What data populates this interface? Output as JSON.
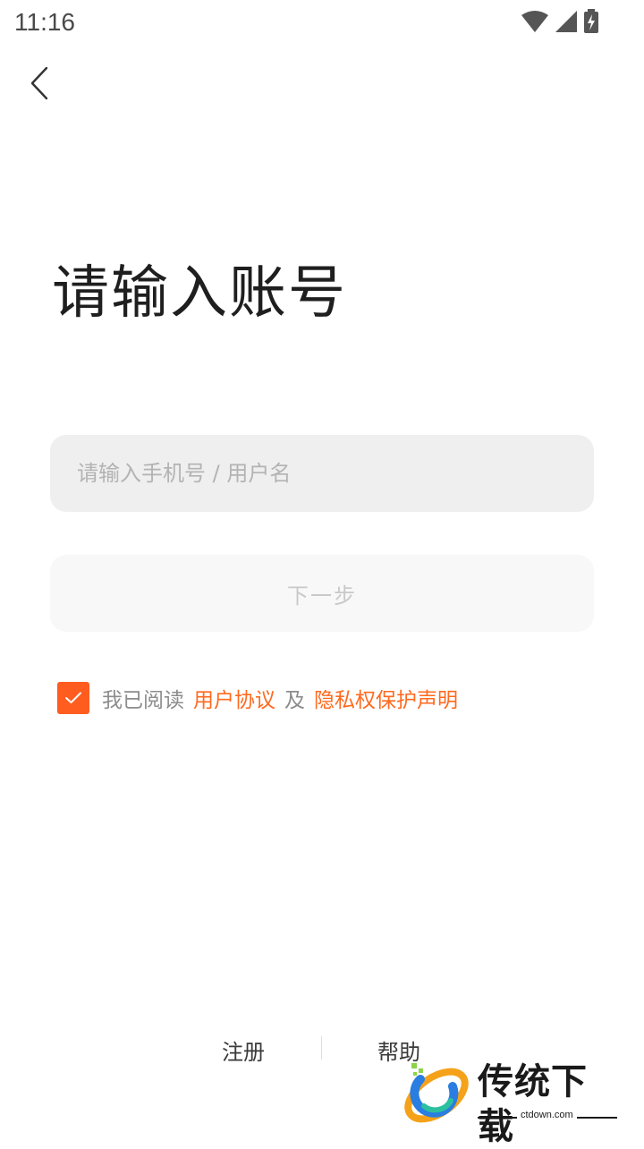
{
  "status_bar": {
    "time": "11:16",
    "icons": [
      "wifi-icon",
      "cell-signal-icon",
      "battery-charging-icon"
    ]
  },
  "header": {
    "back_icon": "chevron-left-icon"
  },
  "main": {
    "title": "请输入账号",
    "account_input": {
      "value": "",
      "placeholder": "请输入手机号 / 用户名"
    },
    "next_button_label": "下一步",
    "agreement": {
      "checked": true,
      "prefix": "我已阅读",
      "user_agreement": "用户协议",
      "conjunction": "及",
      "privacy_statement": "隐私权保护声明"
    }
  },
  "footer": {
    "register_label": "注册",
    "help_label": "帮助"
  },
  "watermark": {
    "brand": "传统下载",
    "url": "ctdown.com"
  },
  "colors": {
    "accent": "#ff5c1f",
    "link": "#ff6a1f",
    "input_bg": "#efefef",
    "button_disabled_bg": "#f8f8f8",
    "button_disabled_text": "#c9c9c9"
  }
}
